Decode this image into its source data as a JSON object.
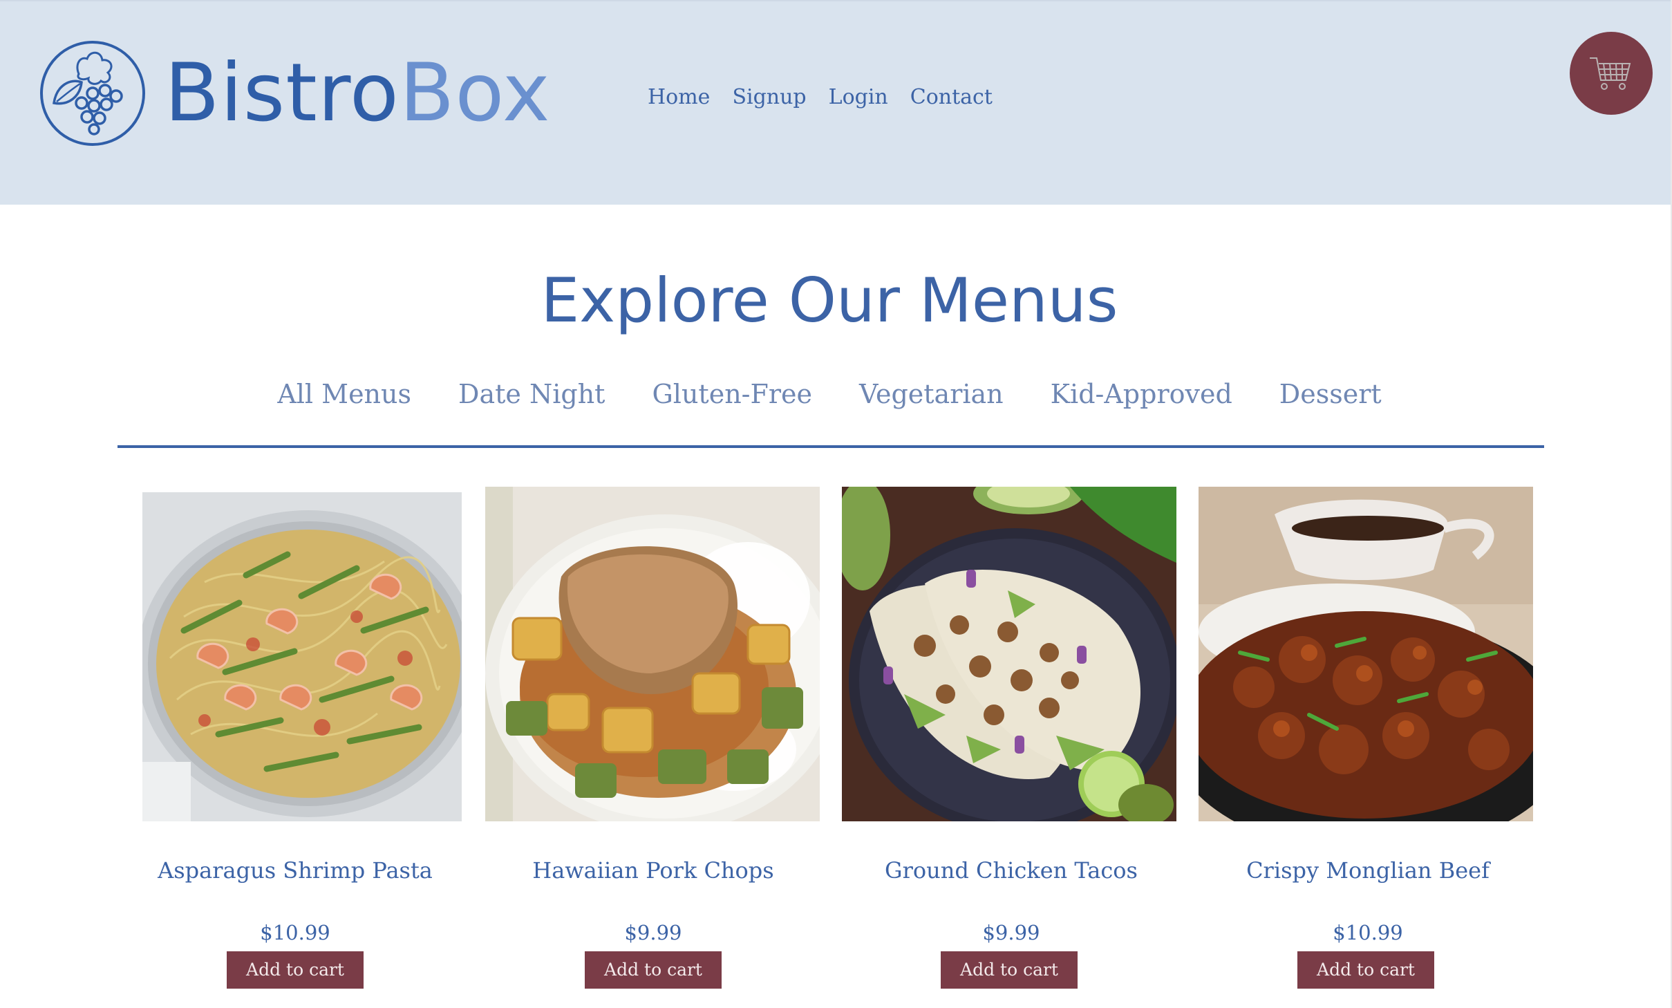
{
  "brand": {
    "name_part1": "Bistro",
    "name_part2": "Box",
    "logo_icon": "grape-leaf-logo-icon",
    "primary_color": "#2f5ea8",
    "secondary_color": "#6a90cf"
  },
  "nav": {
    "items": [
      {
        "label": "Home"
      },
      {
        "label": "Signup"
      },
      {
        "label": "Login"
      },
      {
        "label": "Contact"
      }
    ]
  },
  "cart": {
    "icon": "shopping-cart-icon",
    "color": "#7a3c47"
  },
  "main": {
    "title": "Explore Our Menus",
    "tabs": [
      {
        "label": "All Menus"
      },
      {
        "label": "Date Night"
      },
      {
        "label": "Gluten-Free"
      },
      {
        "label": "Vegetarian"
      },
      {
        "label": "Kid-Approved"
      },
      {
        "label": "Dessert"
      }
    ],
    "products": [
      {
        "name": "Asparagus Shrimp Pasta",
        "price": "$10.99",
        "button": "Add to cart",
        "image_icon": "shrimp-pasta-photo"
      },
      {
        "name": "Hawaiian Pork Chops",
        "price": "$9.99",
        "button": "Add to cart",
        "image_icon": "pork-chop-photo"
      },
      {
        "name": "Ground Chicken Tacos",
        "price": "$9.99",
        "button": "Add to cart",
        "image_icon": "chicken-tacos-photo"
      },
      {
        "name": "Crispy Monglian Beef",
        "price": "$10.99",
        "button": "Add to cart",
        "image_icon": "mongolian-beef-photo"
      }
    ]
  },
  "colors": {
    "header_bg": "#d9e3ee",
    "accent_blue": "#3c63a6",
    "button_maroon": "#7a3c47"
  }
}
